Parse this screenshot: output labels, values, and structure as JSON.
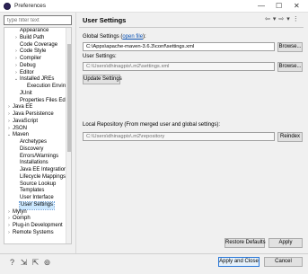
{
  "window": {
    "title": "Preferences",
    "minimize": "—",
    "maximize": "☐",
    "close": "✕"
  },
  "filter": {
    "placeholder": "type filter text"
  },
  "tree": [
    {
      "label": "Appearance",
      "arrow": "",
      "level": 1
    },
    {
      "label": "Build Path",
      "arrow": "›",
      "level": 1
    },
    {
      "label": "Code Coverage",
      "arrow": "",
      "level": 1
    },
    {
      "label": "Code Style",
      "arrow": "›",
      "level": 1
    },
    {
      "label": "Compiler",
      "arrow": "›",
      "level": 1
    },
    {
      "label": "Debug",
      "arrow": "›",
      "level": 1
    },
    {
      "label": "Editor",
      "arrow": "›",
      "level": 1
    },
    {
      "label": "Installed JREs",
      "arrow": "⌄",
      "level": 1
    },
    {
      "label": "Execution Environ",
      "arrow": "",
      "level": 2
    },
    {
      "label": "JUnit",
      "arrow": "",
      "level": 1
    },
    {
      "label": "Properties Files Editor",
      "arrow": "",
      "level": 1
    },
    {
      "label": "Java EE",
      "arrow": "›",
      "level": 0
    },
    {
      "label": "Java Persistence",
      "arrow": "›",
      "level": 0
    },
    {
      "label": "JavaScript",
      "arrow": "›",
      "level": 0
    },
    {
      "label": "JSON",
      "arrow": "›",
      "level": 0
    },
    {
      "label": "Maven",
      "arrow": "⌄",
      "level": 0
    },
    {
      "label": "Archetypes",
      "arrow": "",
      "level": 1
    },
    {
      "label": "Discovery",
      "arrow": "",
      "level": 1
    },
    {
      "label": "Errors/Warnings",
      "arrow": "",
      "level": 1
    },
    {
      "label": "Installations",
      "arrow": "",
      "level": 1
    },
    {
      "label": "Java EE Integration",
      "arrow": "",
      "level": 1
    },
    {
      "label": "Lifecycle Mappings",
      "arrow": "",
      "level": 1
    },
    {
      "label": "Source Lookup",
      "arrow": "",
      "level": 1
    },
    {
      "label": "Templates",
      "arrow": "",
      "level": 1
    },
    {
      "label": "User Interface",
      "arrow": "",
      "level": 1
    },
    {
      "label": "User Settings",
      "arrow": "",
      "level": 1,
      "selected": true
    },
    {
      "label": "Mylyn",
      "arrow": "›",
      "level": 0
    },
    {
      "label": "Oomph",
      "arrow": "›",
      "level": 0
    },
    {
      "label": "Plug-in Development",
      "arrow": "›",
      "level": 0
    },
    {
      "label": "Remote Systems",
      "arrow": "›",
      "level": 0
    }
  ],
  "page": {
    "title": "User Settings",
    "global": {
      "label_prefix": "Global Settings (",
      "link": "open file",
      "label_suffix": "):",
      "value": "C:\\Apps\\apache-maven-3.6.3\\conf\\settings.xml",
      "browse": "Browse..."
    },
    "user": {
      "label": "User Settings:",
      "value": "C:\\Users\\dhinagpis\\.m2\\settings.xml",
      "browse": "Browse...",
      "update": "Update Settings"
    },
    "local_repo": {
      "label": "Local Repository (From merged user and global settings):",
      "value": "C:\\Users\\dhinagpis\\.m2\\repository",
      "reindex": "Reindex"
    },
    "restore_defaults": "Restore Defaults",
    "apply": "Apply"
  },
  "footer": {
    "apply_close": "Apply and Close",
    "cancel": "Cancel",
    "icons": [
      "help-icon",
      "import-icon",
      "export-icon",
      "link-icon"
    ]
  }
}
